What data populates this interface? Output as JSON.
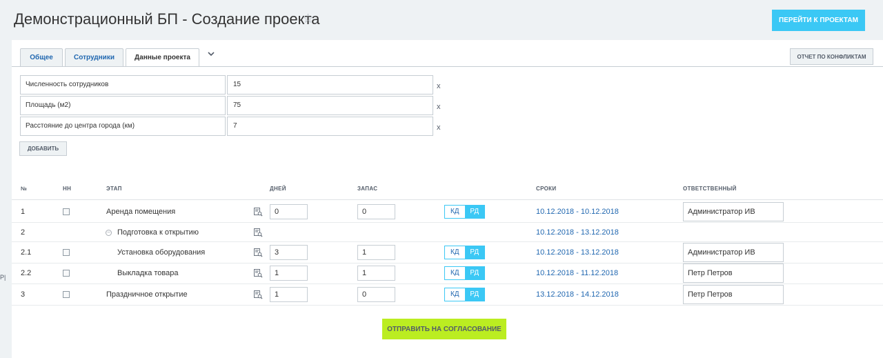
{
  "header": {
    "title": "Демонстрационный БП - Создание проекта",
    "star_icon": "star-icon",
    "goto_projects_label": "ПЕРЕЙТИ К ПРОЕКТАМ"
  },
  "tabs": [
    {
      "label": "Общее",
      "active": false
    },
    {
      "label": "Сотрудники",
      "active": false
    },
    {
      "label": "Данные проекта",
      "active": true
    }
  ],
  "more_tabs_icon": "chevron-down-icon",
  "conflict_report_label": "ОТЧЕТ ПО КОНФЛИКТАМ",
  "properties": [
    {
      "label": "Численность сотрудников",
      "value": "15",
      "remove": "x"
    },
    {
      "label": "Площадь (м2)",
      "value": "75",
      "remove": "x"
    },
    {
      "label": "Расстояние до центра города (км)",
      "value": "7",
      "remove": "x"
    }
  ],
  "add_label": "ДОБАВИТЬ",
  "table": {
    "headers": {
      "num": "№",
      "nn": "НН",
      "stage": "ЭТАП",
      "days": "ДНЕЙ",
      "reserve": "ЗАПАС",
      "dates": "СРОКИ",
      "responsible": "ОТВЕТСТВЕННЫЙ"
    },
    "toggle_labels": {
      "kd": "КД",
      "rd": "РД"
    },
    "rows": [
      {
        "num": "1",
        "stage": "Аренда помещения",
        "days": "0",
        "reserve": "0",
        "dates": "10.12.2018 - 10.12.2018",
        "responsible": "Администратор ИВ"
      },
      {
        "num": "2",
        "stage": "Подготовка к открытию",
        "dates": "10.12.2018 - 13.12.2018",
        "group": true
      },
      {
        "num": "2.1",
        "stage": "Установка оборудования",
        "days": "3",
        "reserve": "1",
        "dates": "10.12.2018 - 13.12.2018",
        "responsible": "Администратор ИВ"
      },
      {
        "num": "2.2",
        "stage": "Выкладка товара",
        "days": "1",
        "reserve": "1",
        "dates": "10.12.2018 - 11.12.2018",
        "responsible": "Петр Петров"
      },
      {
        "num": "3",
        "stage": "Праздничное открытие",
        "days": "1",
        "reserve": "0",
        "dates": "13.12.2018 - 14.12.2018",
        "responsible": "Петр Петров"
      }
    ]
  },
  "submit_label": "ОТПРАВИТЬ НА СОГЛАСОВАНИЕ",
  "edge_glyph": "Р|",
  "colors": {
    "accent": "#3bc8f5",
    "submit": "#bbed21",
    "link": "#2067b0",
    "background": "#eef2f4"
  }
}
